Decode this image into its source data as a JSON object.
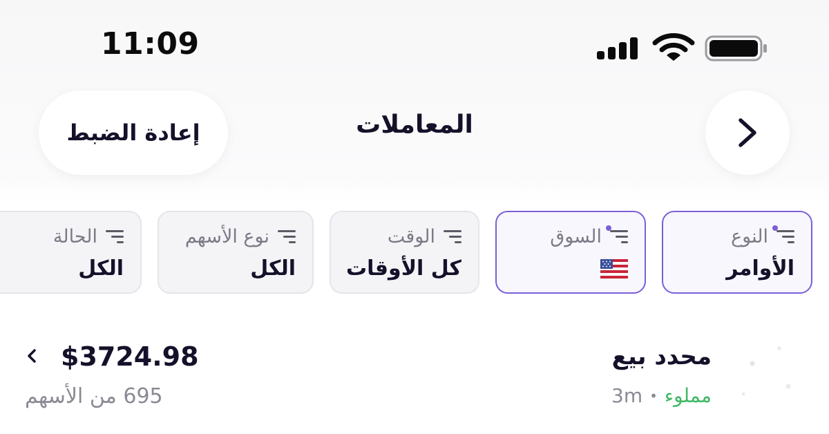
{
  "status_bar": {
    "time": "11:09",
    "icons": [
      "cellular-signal-icon",
      "wifi-icon",
      "battery-icon"
    ]
  },
  "header": {
    "title": "المعاملات",
    "reset_label": "إعادة الضبط",
    "back_icon": "chevron-right-icon"
  },
  "filters": [
    {
      "label": "النوع",
      "value": "الأوامر",
      "active": true
    },
    {
      "label": "السوق",
      "value": "",
      "value_icon": "us-flag-icon",
      "active": true
    },
    {
      "label": "الوقت",
      "value": "كل الأوقات",
      "active": false
    },
    {
      "label": "نوع الأسهم",
      "value": "الكل",
      "active": false
    },
    {
      "label": "الحالة",
      "value": "الكل",
      "active": false
    }
  ],
  "orders": [
    {
      "type": "محدد بيع",
      "time": "3m",
      "status": "مملوء",
      "amount": "$3724.98",
      "shares": "695 من الأسهم"
    }
  ],
  "colors": {
    "accent": "#7b5ed8",
    "filled_status": "#3fb865",
    "text_primary": "#15112a",
    "text_secondary": "#8a8a94"
  }
}
